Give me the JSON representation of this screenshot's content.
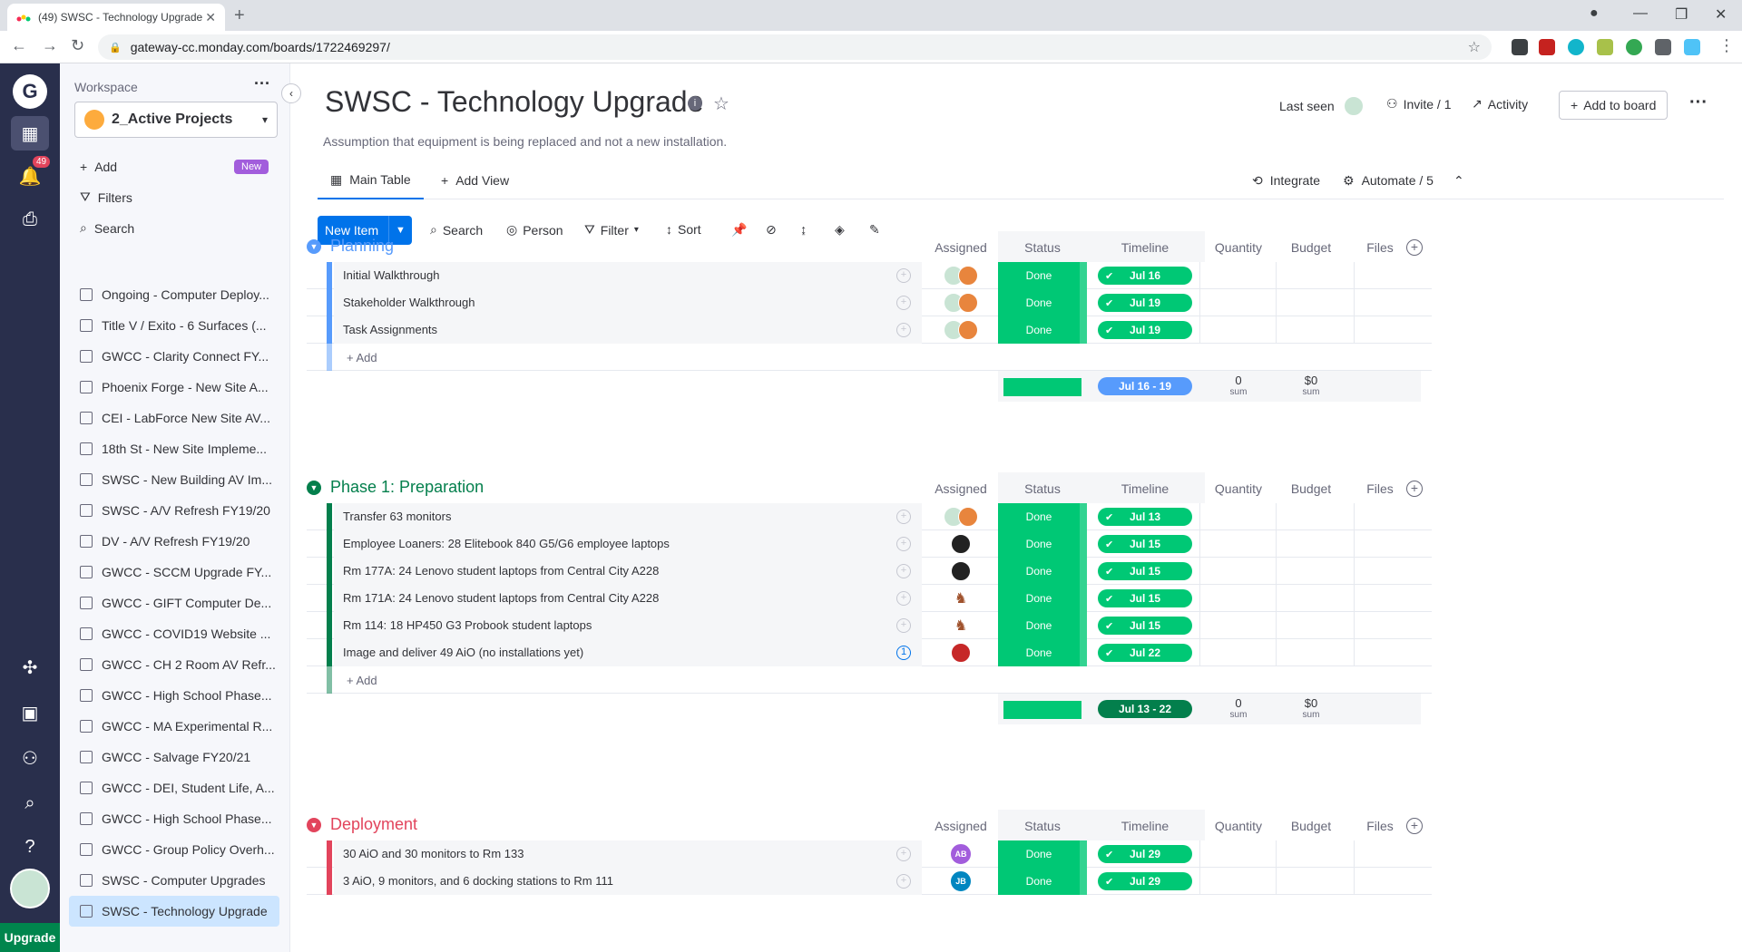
{
  "browser": {
    "tab_title": "(49) SWSC - Technology Upgrade",
    "url": "gateway-cc.monday.com/boards/1722469297/"
  },
  "sidebar": {
    "notification_count": "49",
    "upgrade_label": "Upgrade"
  },
  "workspace": {
    "label": "Workspace",
    "selected": "2_Active Projects",
    "actions": {
      "add": "Add",
      "new_badge": "New",
      "filters": "Filters",
      "search": "Search"
    },
    "boards": [
      "Ongoing - Computer Deploy...",
      "Title V / Exito - 6 Surfaces (...",
      "GWCC - Clarity Connect FY...",
      "Phoenix Forge - New Site A...",
      "CEI - LabForce New Site AV...",
      "18th St - New Site Impleme...",
      "SWSC - New Building AV Im...",
      "SWSC - A/V Refresh FY19/20",
      "DV - A/V Refresh FY19/20",
      "GWCC - SCCM Upgrade FY...",
      "GWCC - GIFT Computer De...",
      "GWCC - COVID19 Website ...",
      "GWCC - CH 2 Room AV Refr...",
      "GWCC - High School Phase...",
      "GWCC - MA Experimental R...",
      "GWCC - Salvage FY20/21",
      "GWCC - DEI, Student Life, A...",
      "GWCC - High School Phase...",
      "GWCC - Group Policy Overh...",
      "SWSC - Computer Upgrades",
      "SWSC - Technology Upgrade"
    ]
  },
  "board": {
    "title": "SWSC - Technology Upgrade",
    "description": "Assumption that equipment is being replaced and not a new installation.",
    "header": {
      "last_seen": "Last seen",
      "invite": "Invite / 1",
      "activity": "Activity",
      "add_to_board": "Add to board"
    },
    "views": {
      "main_table": "Main Table",
      "add_view": "Add View",
      "integrate": "Integrate",
      "automate": "Automate / 5"
    },
    "toolbar": {
      "new_item": "New Item",
      "search": "Search",
      "person": "Person",
      "filter": "Filter",
      "sort": "Sort"
    },
    "columns": {
      "assigned": "Assigned",
      "status": "Status",
      "timeline": "Timeline",
      "quantity": "Quantity",
      "budget": "Budget",
      "files": "Files"
    },
    "add_label": "+ Add",
    "sum_label": "sum",
    "groups": [
      {
        "name": "Planning",
        "color": "#579bfc",
        "summary_timeline_color": "#579bfc",
        "rows": [
          {
            "name": "Initial Walkthrough",
            "status": "Done",
            "timeline": "Jul 16"
          },
          {
            "name": "Stakeholder Walkthrough",
            "status": "Done",
            "timeline": "Jul 19"
          },
          {
            "name": "Task Assignments",
            "status": "Done",
            "timeline": "Jul 19"
          }
        ],
        "summary": {
          "timeline": "Jul 16 - 19",
          "quantity": "0",
          "budget": "$0"
        }
      },
      {
        "name": "Phase 1: Preparation",
        "color": "#037f4c",
        "summary_timeline_color": "#037f4c",
        "rows": [
          {
            "name": "Transfer 63 monitors",
            "status": "Done",
            "timeline": "Jul 13"
          },
          {
            "name": "Employee Loaners: 28 Elitebook 840 G5/G6 employee laptops",
            "status": "Done",
            "timeline": "Jul 15"
          },
          {
            "name": "Rm 177A: 24 Lenovo student laptops from Central City A228",
            "status": "Done",
            "timeline": "Jul 15"
          },
          {
            "name": "Rm 171A: 24 Lenovo student laptops from Central City A228",
            "status": "Done",
            "timeline": "Jul 15"
          },
          {
            "name": "Rm 114: 18 HP450 G3 Probook student laptops",
            "status": "Done",
            "timeline": "Jul 15"
          },
          {
            "name": "Image and deliver 49 AiO (no installations yet)",
            "status": "Done",
            "timeline": "Jul 22",
            "updates": "1"
          }
        ],
        "summary": {
          "timeline": "Jul 13 - 22",
          "quantity": "0",
          "budget": "$0"
        }
      },
      {
        "name": "Deployment",
        "color": "#e2445c",
        "rows": [
          {
            "name": "30 AiO and 30 monitors to Rm 133",
            "status": "Done",
            "timeline": "Jul 29",
            "avatar": "AB",
            "avatar_color": "#a25ddc"
          },
          {
            "name": "3 AiO, 9 monitors, and 6 docking stations to Rm 111",
            "status": "Done",
            "timeline": "Jul 29",
            "avatar": "JB",
            "avatar_color": "#0086c0"
          }
        ]
      }
    ]
  }
}
